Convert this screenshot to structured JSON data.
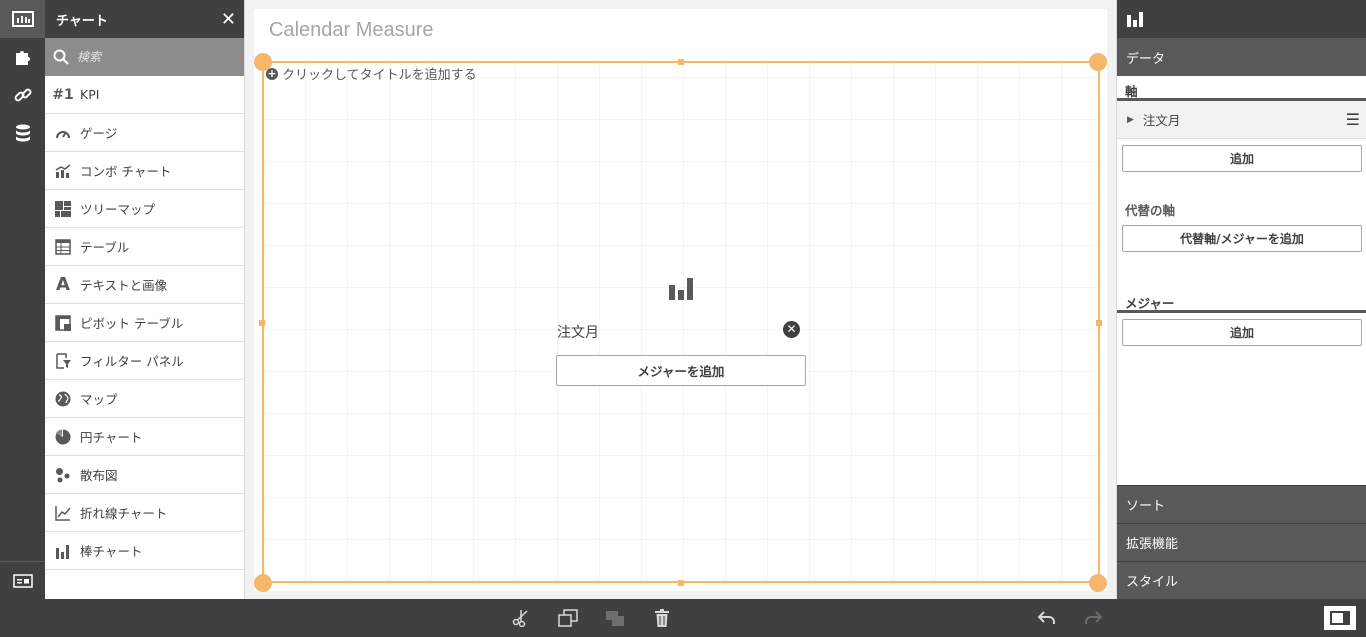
{
  "assets": {
    "header_title": "チャート",
    "search_placeholder": "検索",
    "items": [
      {
        "label": "KPI",
        "icon": "kpi-icon"
      },
      {
        "label": "ゲージ",
        "icon": "gauge-icon"
      },
      {
        "label": "コンボ チャート",
        "icon": "combo-chart-icon"
      },
      {
        "label": "ツリーマップ",
        "icon": "treemap-icon"
      },
      {
        "label": "テーブル",
        "icon": "table-icon"
      },
      {
        "label": "テキストと画像",
        "icon": "text-image-icon"
      },
      {
        "label": "ピボット テーブル",
        "icon": "pivot-table-icon"
      },
      {
        "label": "フィルター パネル",
        "icon": "filter-pane-icon"
      },
      {
        "label": "マップ",
        "icon": "map-icon"
      },
      {
        "label": "円チャート",
        "icon": "pie-chart-icon"
      },
      {
        "label": "散布図",
        "icon": "scatter-icon"
      },
      {
        "label": "折れ線チャート",
        "icon": "line-chart-icon"
      },
      {
        "label": "棒チャート",
        "icon": "bar-chart-icon"
      }
    ],
    "kpi_glyph": "#1",
    "text_glyph": "A"
  },
  "sheet": {
    "title": "Calendar Measure",
    "add_title_label": "クリックしてタイトルを追加する",
    "dimension_label": "注文月",
    "add_measure_label": "メジャーを追加"
  },
  "properties": {
    "data_tab": "データ",
    "dimensions_title": "軸",
    "dimension_item": "注文月",
    "add_dimension_label": "追加",
    "alternative_title": "代替の軸",
    "add_alternative_label": "代替軸/メジャーを追加",
    "measures_title": "メジャー",
    "add_measure_label": "追加",
    "sections": [
      "ソート",
      "拡張機能",
      "スタイル"
    ]
  },
  "colors": {
    "dark": "#404040",
    "selection": "#f4b76b",
    "panel_mid": "#595959"
  }
}
